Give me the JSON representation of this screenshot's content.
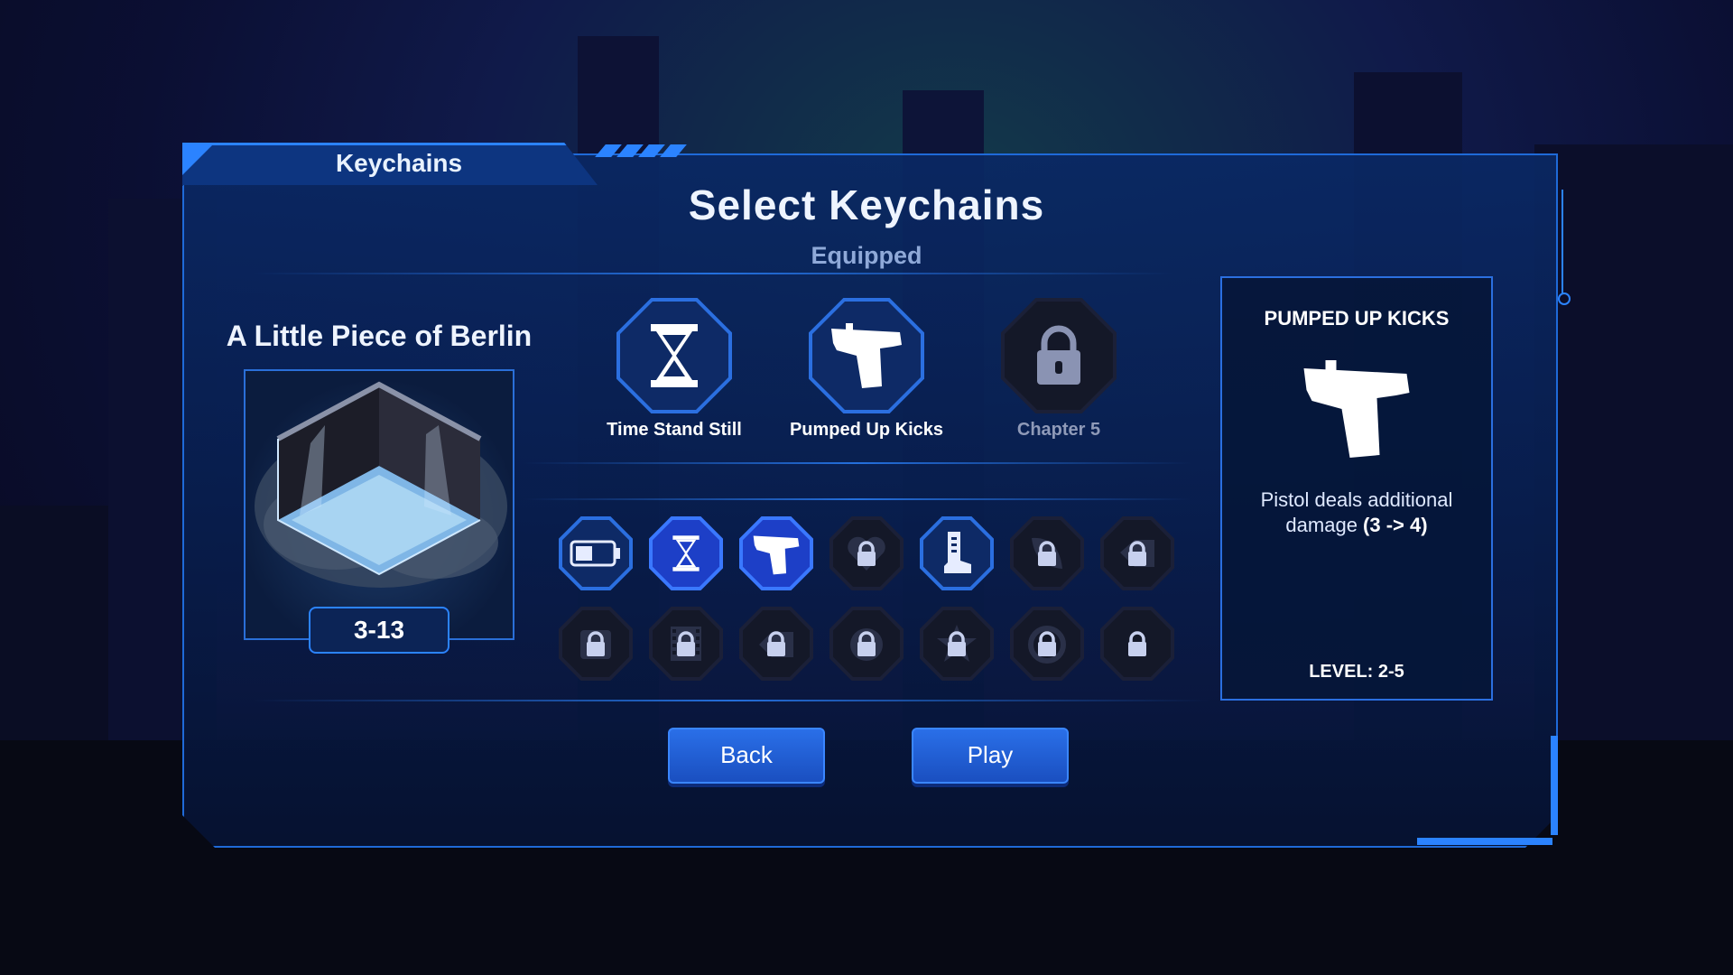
{
  "tab_title": "Keychains",
  "title": "Select Keychains",
  "equipped_label": "Equipped",
  "level": {
    "name": "A Little Piece of Berlin",
    "code": "3-13"
  },
  "equipped": [
    {
      "label": "Time Stand Still",
      "icon": "hourglass-icon",
      "locked": false
    },
    {
      "label": "Pumped Up Kicks",
      "icon": "pistol-icon",
      "locked": false
    },
    {
      "label": "Chapter 5",
      "icon": "lock-icon",
      "locked": true
    }
  ],
  "inventory_row1": [
    {
      "icon": "battery-icon",
      "state": "unlocked"
    },
    {
      "icon": "hourglass-icon",
      "state": "selected"
    },
    {
      "icon": "pistol-icon",
      "state": "selected"
    },
    {
      "icon": "heart-lock-icon",
      "state": "locked"
    },
    {
      "icon": "boot-icon",
      "state": "unlocked"
    },
    {
      "icon": "leaf-lock-icon",
      "state": "locked"
    },
    {
      "icon": "lock-icon",
      "state": "locked"
    }
  ],
  "inventory_row2": [
    {
      "icon": "lock-icon",
      "state": "locked"
    },
    {
      "icon": "film-lock-icon",
      "state": "locked"
    },
    {
      "icon": "lock-icon",
      "state": "locked"
    },
    {
      "icon": "lock-icon",
      "state": "locked"
    },
    {
      "icon": "star-lock-icon",
      "state": "locked"
    },
    {
      "icon": "lock-icon",
      "state": "locked"
    },
    {
      "icon": "lock-icon",
      "state": "locked"
    }
  ],
  "info": {
    "title": "PUMPED UP KICKS",
    "icon": "pistol-icon",
    "desc_prefix": "Pistol deals additional damage ",
    "desc_bold": "(3 -> 4)",
    "level": "LEVEL: 2-5"
  },
  "buttons": {
    "back": "Back",
    "play": "Play"
  },
  "colors": {
    "accent": "#2b83ff",
    "panel": "#0b2a6e",
    "selected": "#1d3fc7"
  }
}
